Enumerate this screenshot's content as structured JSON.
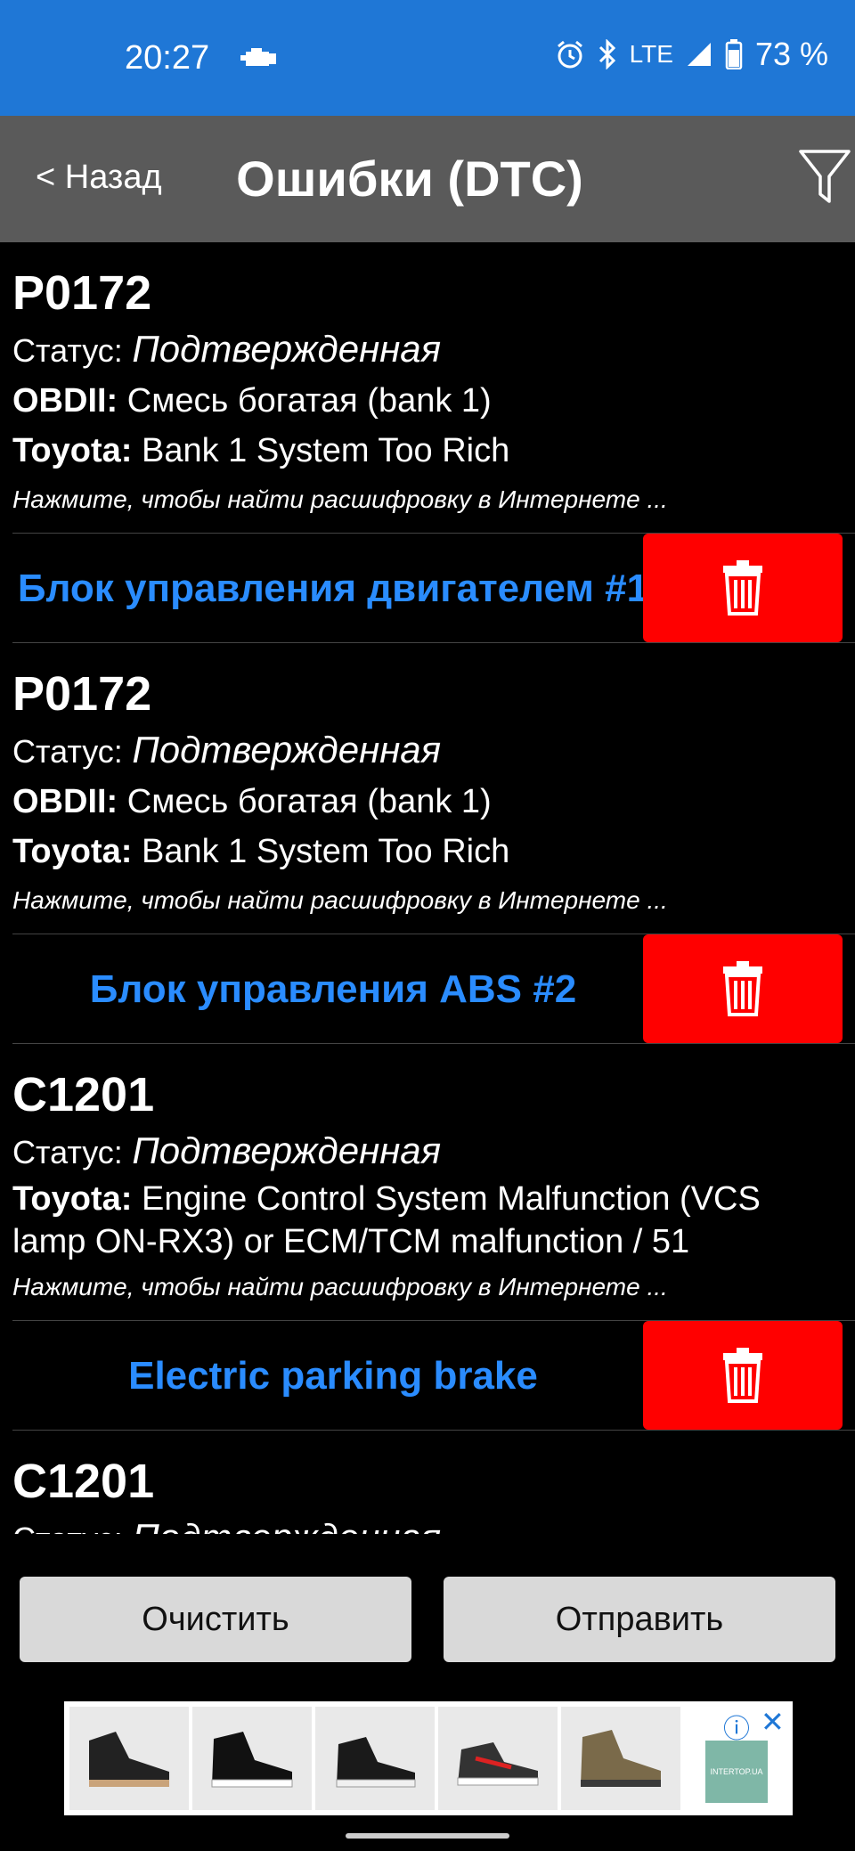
{
  "status_bar": {
    "time": "20:27",
    "network": "LTE",
    "battery": "73 %",
    "icons": [
      "engine-icon",
      "alarm-icon",
      "bluetooth-icon",
      "signal-icon",
      "battery-icon"
    ]
  },
  "header": {
    "back_label": "< Назад",
    "title": "Ошибки (DTC)",
    "filter_icon": "filter-icon"
  },
  "dtc_list": [
    {
      "code": "P0172",
      "status_label": "Статус:",
      "status_value": "Подтвержденная",
      "obd_label": "OBDII:",
      "obd_desc": "Смесь богатая (bank 1)",
      "maker_label": "Toyota:",
      "maker_desc": "Bank 1 System Too Rich",
      "hint": "Нажмите, чтобы найти расшифровку в Интернете ...",
      "unit": "Блок управления двигателем #1"
    },
    {
      "code": "P0172",
      "status_label": "Статус:",
      "status_value": "Подтвержденная",
      "obd_label": "OBDII:",
      "obd_desc": "Смесь богатая (bank 1)",
      "maker_label": "Toyota:",
      "maker_desc": "Bank 1 System Too Rich",
      "hint": "Нажмите, чтобы найти расшифровку в Интернете ...",
      "unit": "Блок управления ABS #2"
    },
    {
      "code": "C1201",
      "status_label": "Статус:",
      "status_value": "Подтвержденная",
      "maker_label": "Toyota:",
      "maker_desc": "Engine Control System Malfunction (VCS lamp ON-RX3) or ECM/TCM malfunction / 51",
      "hint": "Нажмите, чтобы найти расшифровку в Интернете ...",
      "unit": "Electric parking brake"
    },
    {
      "code": "C1201",
      "status_label": "Статус:",
      "status_value": "Подтвержденная"
    }
  ],
  "actions": {
    "clear_label": "Очистить",
    "send_label": "Отправить"
  },
  "ad": {
    "logo_text": "INTERTOP.UA",
    "info_glyph": "ⓘ",
    "close_glyph": "✕"
  },
  "colors": {
    "status_bar": "#1f77d6",
    "header": "#5a5a5a",
    "unit_text": "#2a8cff",
    "delete": "#ff0000",
    "button": "#d9d9d9"
  }
}
